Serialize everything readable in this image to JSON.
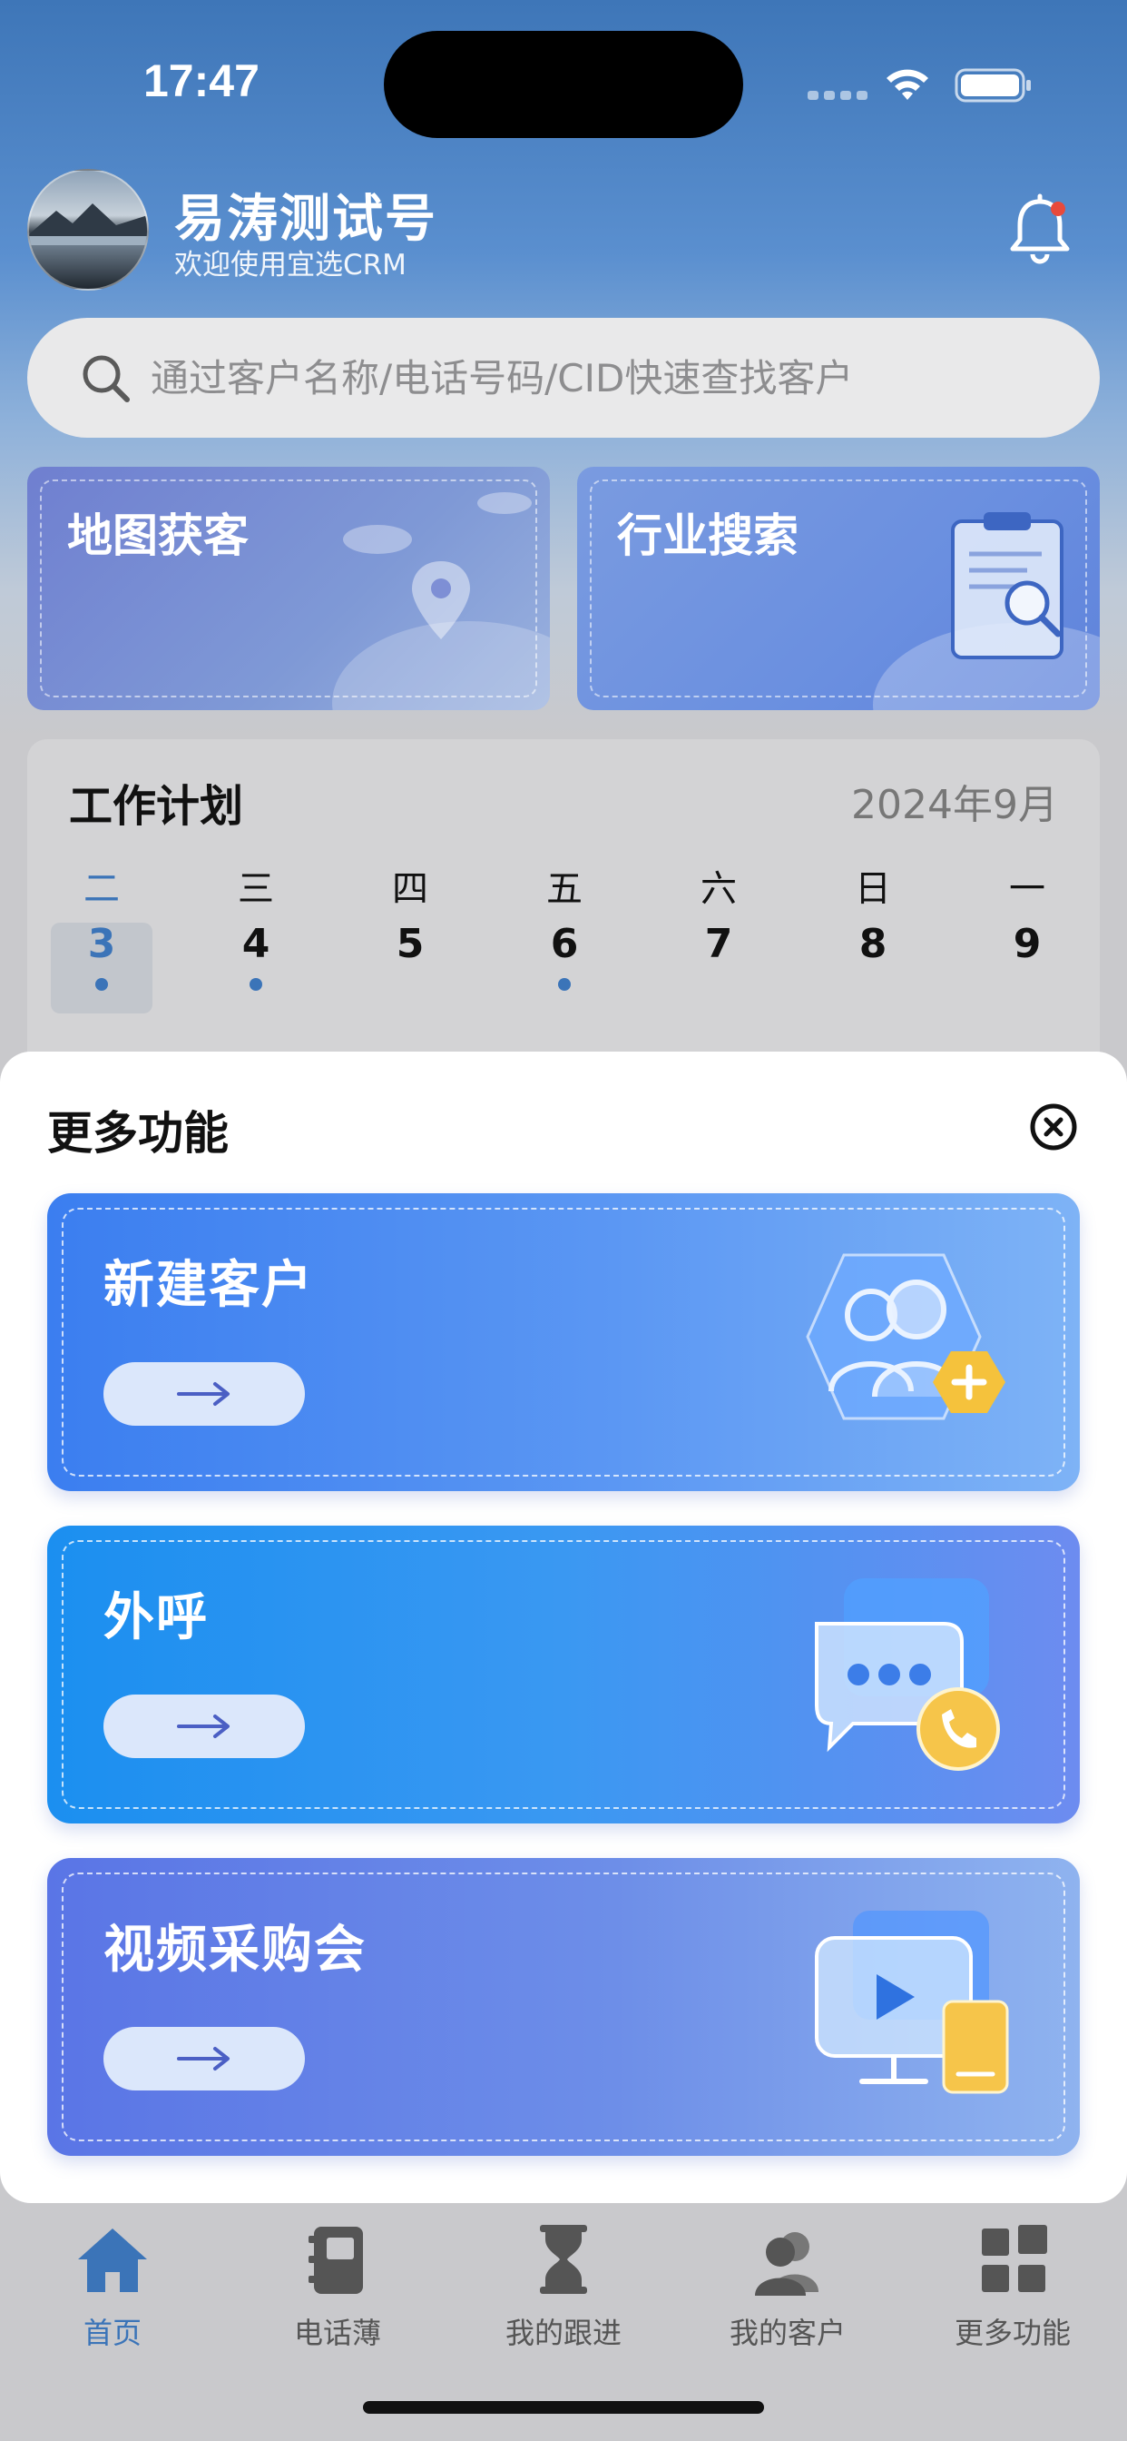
{
  "status_bar": {
    "time": "17:47"
  },
  "header": {
    "user_name": "易涛测试号",
    "subtitle": "欢迎使用宜选CRM"
  },
  "search": {
    "placeholder": "通过客户名称/电话号码/CID快速查找客户"
  },
  "quick_cards": [
    {
      "label": "地图获客",
      "icon": "map-pin-icon"
    },
    {
      "label": "行业搜索",
      "icon": "document-search-icon"
    }
  ],
  "work_plan": {
    "title": "工作计划",
    "month": "2024年9月",
    "days": [
      {
        "dow": "二",
        "num": "3",
        "has_event": true,
        "selected": true
      },
      {
        "dow": "三",
        "num": "4",
        "has_event": true,
        "selected": false
      },
      {
        "dow": "四",
        "num": "5",
        "has_event": false,
        "selected": false
      },
      {
        "dow": "五",
        "num": "6",
        "has_event": true,
        "selected": false
      },
      {
        "dow": "六",
        "num": "7",
        "has_event": false,
        "selected": false
      },
      {
        "dow": "日",
        "num": "8",
        "has_event": false,
        "selected": false
      },
      {
        "dow": "一",
        "num": "9",
        "has_event": false,
        "selected": false
      }
    ]
  },
  "sheet": {
    "title": "更多功能",
    "features": [
      {
        "title": "新建客户",
        "icon": "add-user-icon"
      },
      {
        "title": "外呼",
        "icon": "chat-phone-icon"
      },
      {
        "title": "视频采购会",
        "icon": "video-monitor-icon"
      }
    ]
  },
  "tabbar": {
    "items": [
      {
        "label": "首页",
        "icon": "home-icon",
        "active": true
      },
      {
        "label": "电话薄",
        "icon": "phonebook-icon",
        "active": false
      },
      {
        "label": "我的跟进",
        "icon": "hourglass-icon",
        "active": false
      },
      {
        "label": "我的客户",
        "icon": "customers-icon",
        "active": false
      },
      {
        "label": "更多功能",
        "icon": "grid-icon",
        "active": false
      }
    ]
  },
  "colors": {
    "accent": "#3b74b8",
    "notification_dot": "#e84a3c",
    "sheet_background": "#ffffff"
  }
}
